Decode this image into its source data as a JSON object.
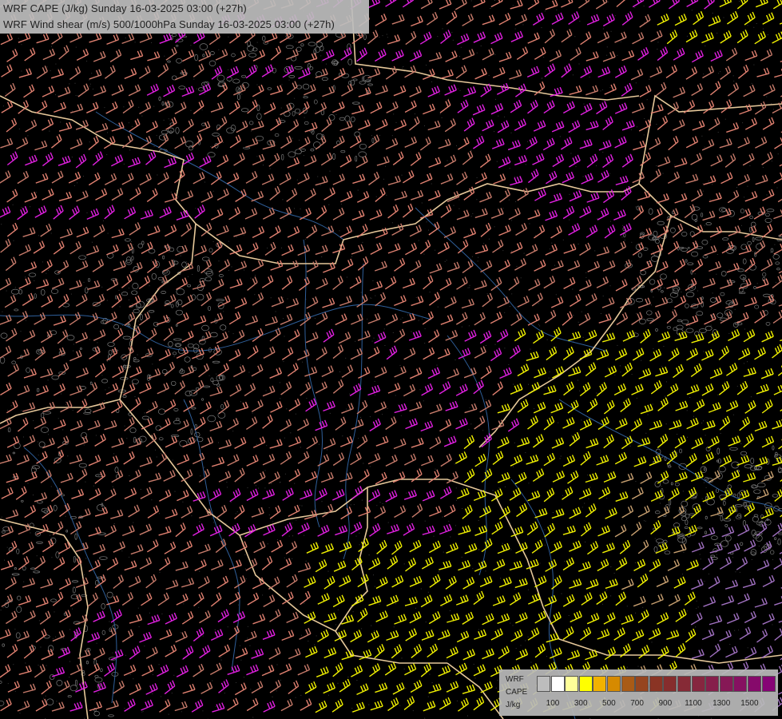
{
  "header": {
    "line1": "WRF CAPE (J/kg) Sunday 16-03-2025 03:00 (+27h)",
    "line2": "WRF Wind shear (m/s) 500/1000hPa Sunday 16-03-2025 03:00 (+27h)"
  },
  "legend": {
    "label_lines": [
      "WRF",
      "CAPE",
      "J/kg"
    ],
    "colors": [
      "#bdbdbd",
      "#ffffff",
      "#ffff99",
      "#ffff00",
      "#f2b200",
      "#d68a00",
      "#a95b16",
      "#96451f",
      "#8a3424",
      "#862d2d",
      "#862a36",
      "#86263f",
      "#861f4b",
      "#861856",
      "#861161",
      "#860a6b",
      "#860475"
    ],
    "ticks": [
      "100",
      "300",
      "500",
      "700",
      "900",
      "1100",
      "1300",
      "1500"
    ]
  },
  "layers": {
    "cape_field": "CAPE",
    "wind_barbs": "Wind shear barbs",
    "borders": "country borders",
    "rivers": "rivers",
    "terrain": "terrain contours"
  },
  "barb_colors": {
    "low": "#c67a6a",
    "mid": "#e08070",
    "high": "#e020e0",
    "yellow": "#f0f000",
    "tan": "#c8a070",
    "violet": "#a070c0"
  }
}
